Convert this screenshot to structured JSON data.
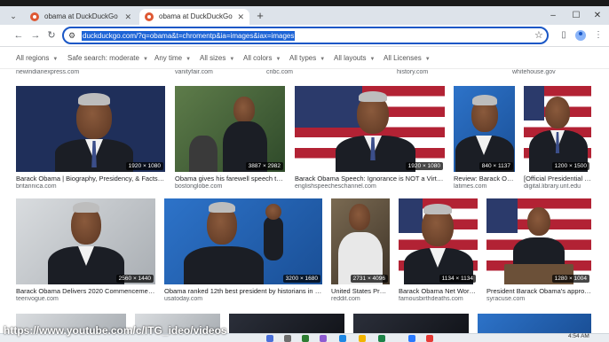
{
  "tabs": [
    {
      "title": "obama at DuckDuckGo",
      "active": false
    },
    {
      "title": "obama at DuckDuckGo",
      "active": true
    }
  ],
  "window_controls": {
    "minimize": "–",
    "maximize": "☐",
    "close": "✕"
  },
  "address_bar": {
    "url": "duckduckgo.com/?q=obama&t=chromentp&ia=images&iax=images"
  },
  "filters": [
    {
      "label": "All regions"
    },
    {
      "label": "Safe search: moderate"
    },
    {
      "label": "Any time"
    },
    {
      "label": "All sizes"
    },
    {
      "label": "All colors"
    },
    {
      "label": "All types"
    },
    {
      "label": "All layouts"
    },
    {
      "label": "All Licenses"
    }
  ],
  "top_sources": [
    "newindianexpress.com",
    "vanityfair.com",
    "cnbc.com",
    "history.com",
    "whitehouse.gov"
  ],
  "row1": [
    {
      "title": "Barack Obama | Biography, Presidency, & Facts | Bri...",
      "source": "britannica.com",
      "dims": "1920 × 1080"
    },
    {
      "title": "Obama gives his farewell speech toni...",
      "source": "bostonglobe.com",
      "dims": "3887 × 2982"
    },
    {
      "title": "Barack Obama Speech: Ignorance is NOT a Virtue - ...",
      "source": "englishspeecheschannel.com",
      "dims": "1920 × 1080"
    },
    {
      "title": "Review: Barack Oba...",
      "source": "latimes.com",
      "dims": "840 × 1137"
    },
    {
      "title": "[Official Presidential P...",
      "source": "digital.library.unt.edu",
      "dims": "1200 × 1500"
    }
  ],
  "row2": [
    {
      "title": "Barack Obama Delivers 2020 Commencement ...",
      "source": "teenvogue.com",
      "dims": "2560 × 1440"
    },
    {
      "title": "Obama ranked 12th best president by historians in ne...",
      "source": "usatoday.com",
      "dims": "3200 × 1680"
    },
    {
      "title": "United States Pres...",
      "source": "reddit.com",
      "dims": "2731 × 4096"
    },
    {
      "title": "Barack Obama Net Worth (...",
      "source": "famousbirthdeaths.com",
      "dims": "1134 × 1134"
    },
    {
      "title": "President Barack Obama's approva...",
      "source": "syracuse.com",
      "dims": "1280 × 1004"
    }
  ],
  "overlay_url": "https://www.youtube.com/c/ITG_ideo/videos",
  "clock": "4:54 AM"
}
